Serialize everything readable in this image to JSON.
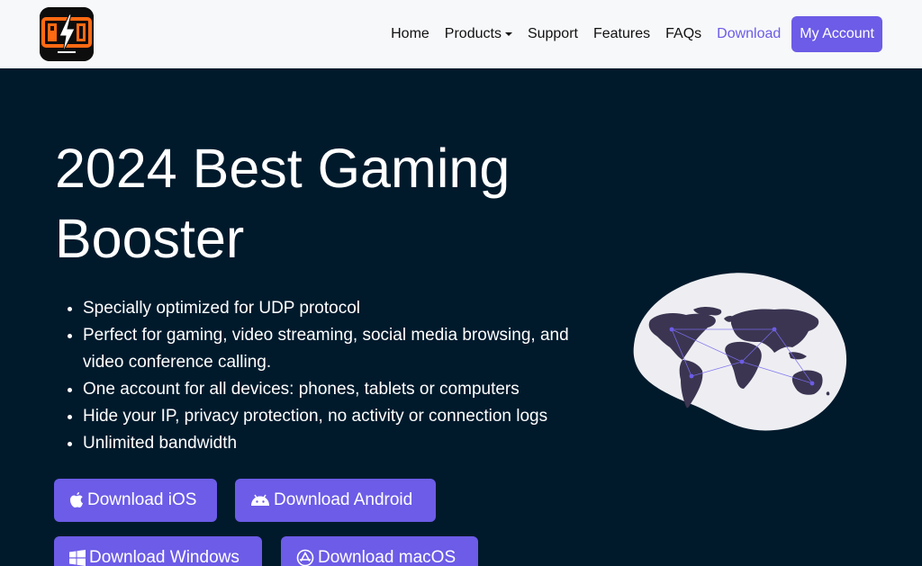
{
  "header": {
    "logo_icon": "pubg-booster-logo",
    "nav": [
      {
        "label": "Home",
        "active": false,
        "dropdown": false
      },
      {
        "label": "Products",
        "active": false,
        "dropdown": true
      },
      {
        "label": "Support",
        "active": false,
        "dropdown": false
      },
      {
        "label": "Features",
        "active": false,
        "dropdown": false
      },
      {
        "label": "FAQs",
        "active": false,
        "dropdown": false
      },
      {
        "label": "Download",
        "active": true,
        "dropdown": false
      }
    ],
    "account_label": "My Account"
  },
  "hero": {
    "title": "2024 Best Gaming Booster",
    "features": [
      "Specially optimized for UDP protocol",
      "Perfect for gaming, video streaming, social media browsing, and video conference calling.",
      "One account for all devices: phones, tablets or computers",
      "Hide your IP, privacy protection, no activity or connection logs",
      "Unlimited bandwidth"
    ],
    "buttons": {
      "ios": "Download iOS",
      "android": "Download Android",
      "windows": "Download Windows",
      "macos": "Download macOS"
    },
    "illustration_icon": "world-map-icon"
  },
  "colors": {
    "accent": "#6c5ce7",
    "hero_bg": "#001a2c",
    "header_bg": "#f7f8fa",
    "logo_orange": "#ff6a13"
  }
}
